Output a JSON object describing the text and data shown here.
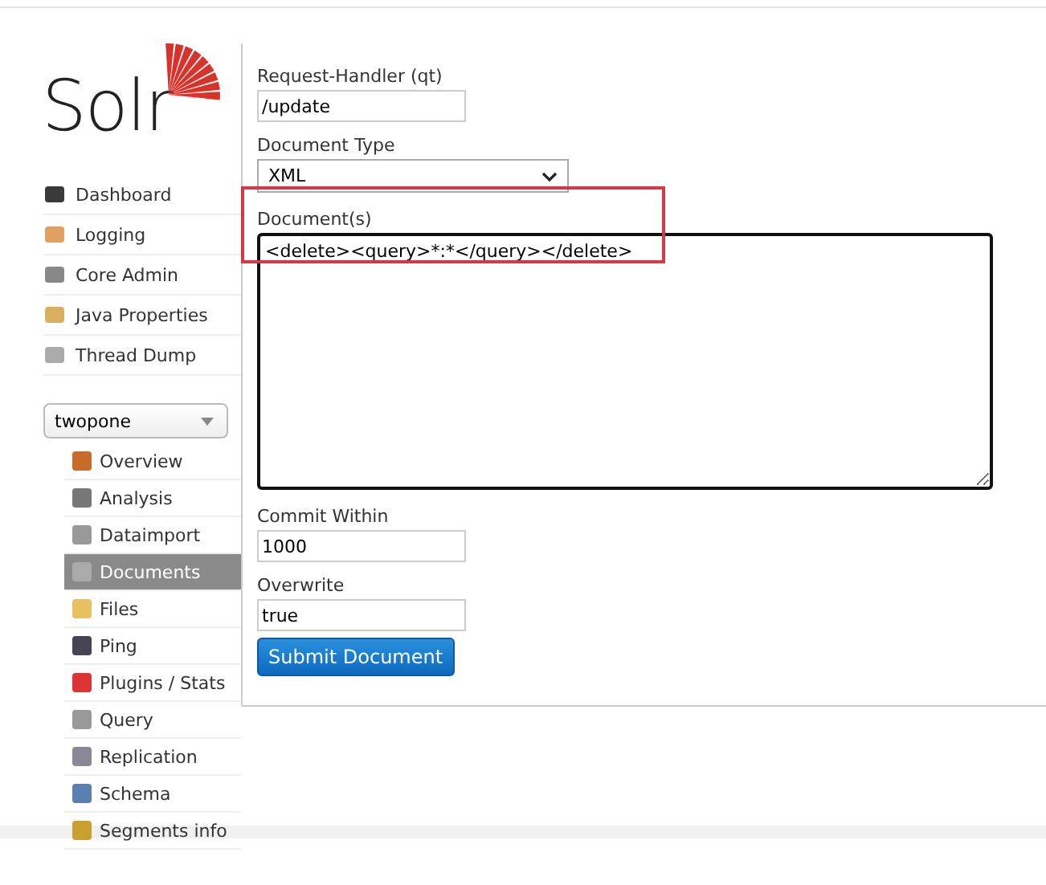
{
  "logo": {
    "text": "Solr"
  },
  "nav": [
    {
      "label": "Dashboard"
    },
    {
      "label": "Logging"
    },
    {
      "label": "Core Admin"
    },
    {
      "label": "Java Properties"
    },
    {
      "label": "Thread Dump"
    }
  ],
  "core_selector": {
    "value": "twopone"
  },
  "core_menu": [
    {
      "label": "Overview",
      "selected": false
    },
    {
      "label": "Analysis",
      "selected": false
    },
    {
      "label": "Dataimport",
      "selected": false
    },
    {
      "label": "Documents",
      "selected": true
    },
    {
      "label": "Files",
      "selected": false
    },
    {
      "label": "Ping",
      "selected": false
    },
    {
      "label": "Plugins / Stats",
      "selected": false
    },
    {
      "label": "Query",
      "selected": false
    },
    {
      "label": "Replication",
      "selected": false
    },
    {
      "label": "Schema",
      "selected": false
    },
    {
      "label": "Segments info",
      "selected": false
    }
  ],
  "form": {
    "request_handler": {
      "label": "Request-Handler (qt)",
      "value": "/update"
    },
    "document_type": {
      "label": "Document Type",
      "value": "XML"
    },
    "documents": {
      "label": "Document(s)",
      "value": "<delete><query>*:*</query></delete>",
      "highlighted": true
    },
    "commit_within": {
      "label": "Commit Within",
      "value": "1000"
    },
    "overwrite": {
      "label": "Overwrite",
      "value": "true"
    },
    "submit": "Submit Document"
  }
}
